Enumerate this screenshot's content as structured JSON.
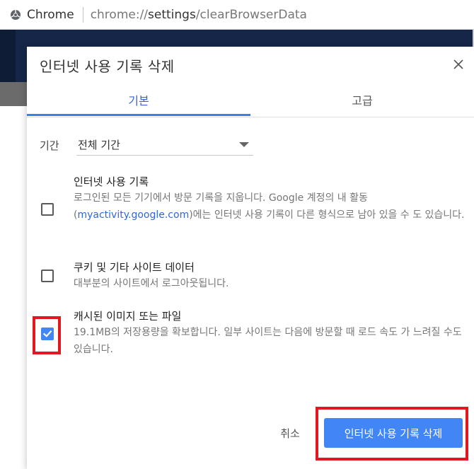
{
  "browser": {
    "site_chip_label": "Chrome",
    "url_scheme": "chrome://",
    "url_host_path": "settings",
    "url_rest": "/clearBrowserData"
  },
  "dialog": {
    "title": "인터넷 사용 기록 삭제",
    "close_icon": "close-icon",
    "tabs": [
      {
        "label": "기본",
        "selected": true
      },
      {
        "label": "고급",
        "selected": false
      }
    ],
    "time_range": {
      "label": "기간",
      "value": "전체 기간"
    },
    "options": [
      {
        "title": "인터넷 사용 기록",
        "desc_pre": "로그인된 모든 기기에서 방문 기록을 지웁니다. Google 계정의 내 활동 (",
        "desc_link": "myactivity.google.com",
        "desc_post": ")에는 인터넷 사용 기록이 다른 형식으로 남아 있을 수 도 있습니다.",
        "checked": false
      },
      {
        "title": "쿠키 및 기타 사이트 데이터",
        "desc": "대부분의 사이트에서 로그아웃됩니다.",
        "checked": false
      },
      {
        "title": "캐시된 이미지 또는 파일",
        "desc": "19.1MB의 저장용량을 확보합니다. 일부 사이트는 다음에 방문할 때 로드 속도 가 느려질 수도 있습니다.",
        "checked": true
      }
    ],
    "cancel_label": "취소",
    "confirm_label": "인터넷 사용 기록 삭제"
  },
  "colors": {
    "accent": "#4285f4",
    "highlight": "#e3171d",
    "tab_selected": "#3367d6"
  }
}
